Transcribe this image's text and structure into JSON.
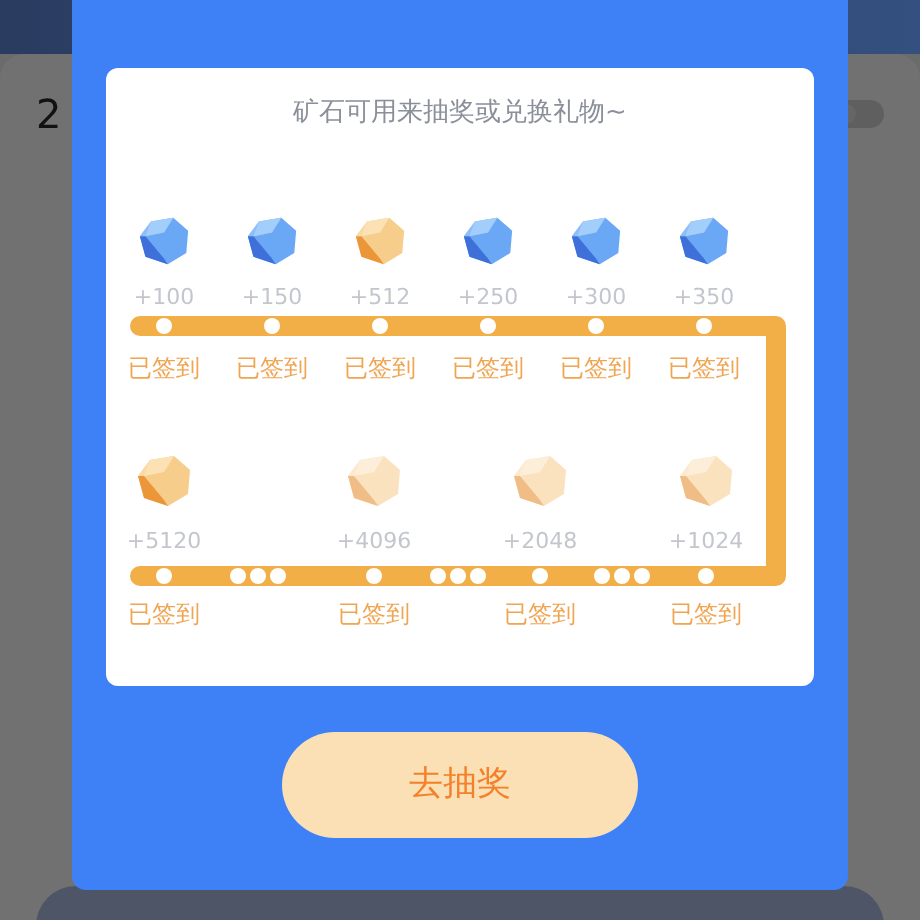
{
  "background": {
    "text": "2",
    "toggle": {
      "on": false
    }
  },
  "modal": {
    "subtitle": "矿石可用来抽奖或兑换礼物~",
    "rows": [
      {
        "kind": "dense",
        "items": [
          {
            "kind": "blue",
            "value": "+100",
            "label": "已签到"
          },
          {
            "kind": "blue",
            "value": "+150",
            "label": "已签到"
          },
          {
            "kind": "gold",
            "value": "+512",
            "label": "已签到"
          },
          {
            "kind": "blue",
            "value": "+250",
            "label": "已签到"
          },
          {
            "kind": "blue",
            "value": "+300",
            "label": "已签到"
          },
          {
            "kind": "blue",
            "value": "+350",
            "label": "已签到"
          }
        ]
      },
      {
        "kind": "spaced",
        "items": [
          {
            "kind": "gold",
            "value": "+5120",
            "label": "已签到"
          },
          {
            "kind": "pale",
            "value": "+4096",
            "label": "已签到"
          },
          {
            "kind": "pale",
            "value": "+2048",
            "label": "已签到"
          },
          {
            "kind": "pale",
            "value": "+1024",
            "label": "已签到"
          }
        ]
      }
    ],
    "button": "去抽奖"
  }
}
